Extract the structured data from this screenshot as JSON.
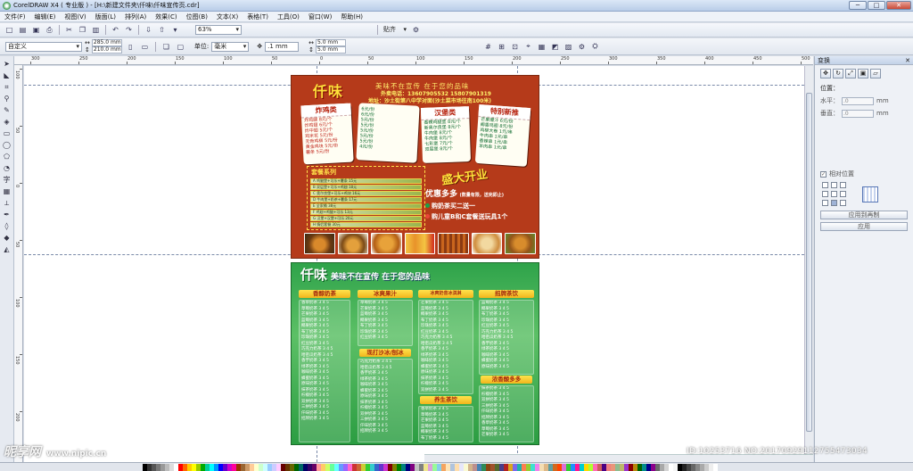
{
  "window": {
    "title": "CorelDRAW X4 ( 专业版 ) - [H:\\新建文件夹\\仟味\\仟味宣传页.cdr]",
    "minimize_label": "─",
    "maximize_label": "□",
    "close_label": "✕"
  },
  "menu": [
    "文件(F)",
    "编辑(E)",
    "视图(V)",
    "版面(L)",
    "排列(A)",
    "效果(C)",
    "位图(B)",
    "文本(X)",
    "表格(T)",
    "工具(O)",
    "窗口(W)",
    "帮助(H)"
  ],
  "toolbar": {
    "zoom": "63%",
    "snap_label": "贴齐"
  },
  "propbar": {
    "paper": "自定义",
    "width": "285.0 mm",
    "height": "210.0 mm",
    "units_label": "单位:",
    "units": "毫米",
    "nudge": ".1 mm",
    "dup_x": "5.0 mm",
    "dup_y": "5.0 mm"
  },
  "ruler": {
    "top_ticks": [
      "300",
      "250",
      "200",
      "150",
      "100",
      "50",
      "0",
      "50",
      "100",
      "150",
      "200",
      "250",
      "300",
      "350",
      "400",
      "450",
      "500"
    ],
    "left_ticks": [
      "100",
      "50",
      "0",
      "50",
      "100",
      "150",
      "200"
    ]
  },
  "flyer_top": {
    "brand": "仟味",
    "slogan": "美味不在宣传    在于您的品味",
    "phone": "外卖电话：13607905532  15807901319",
    "address": "地址：沙土街第八中学对面(沙土菜市场往南100米)",
    "fried_title": "炸鸡类",
    "fried_items": [
      "炸鸡腿   8元/个",
      "炸鸡翅   6元/个",
      "炸中翅   5元/个",
      "鸡米花   5元/份",
      "无骨鸡柳  5元/份",
      "黄金鸡块  5元/份",
      "薯条     5元/份"
    ],
    "mid_items": [
      "6元/份",
      "6元/份",
      "5元/份",
      "5元/份",
      "5元/份",
      "5元/份",
      "5元/份",
      "4元/份"
    ],
    "burger_title": "汉堡类",
    "burger_items": [
      "香辣鸡腿堡  8元/个",
      "新奥尔良堡  8元/个",
      "牛肉堡    8元/个",
      "牛肉堡    8元/个",
      "七彩堡    7元/个",
      "双层堡    8元/个"
    ],
    "special_title": "特别新推",
    "special_items": [
      "芒果爆汁   6元/份",
      "椰香鸡翅   8元/份",
      "鸡柳大卷   1元/串",
      "牛肉串    1元/串",
      "香辣串    1元/串",
      "羊肉串    1元/串"
    ],
    "combo_title": "套餐系列",
    "combos": [
      "A 鸡腿堡+可乐+薯条   15元",
      "B 双层堡+可乐+鸡翅   18元",
      "C 奥尔良堡+可乐+鸡块  16元",
      "D 牛肉堡+奶茶+薯条   17元",
      "E 全家桶      38元",
      "F 鸡翅+鸡腿+可乐    13元",
      "G 汉堡+汉堡+可乐    20元",
      "H 情侣套餐      30元"
    ],
    "grand_opening": "盛大开业",
    "promo_title": "优惠多多",
    "promo_note": "(数量有限，送完即止)",
    "promo_items": [
      "购奶茶买二送一",
      "购儿童B和C套餐送玩具1个"
    ]
  },
  "flyer_bottom": {
    "brand": "仟味",
    "slogan": "美味不在宣传     在于您的品味",
    "headers": [
      "香醇奶茶",
      "冰爽果汁",
      "冰爽奶昔冰淇淋",
      "招牌茶饮",
      "现打沙冰/刨冰",
      "养生茶饮",
      "浓香酸多多"
    ],
    "rows": [
      "香草奶茶  3 4 5",
      "草莓奶茶  3 4 5",
      "芒果奶茶  3 4 5",
      "蓝莓奶茶  3 4 5",
      "椰果奶茶  3 4 5",
      "布丁奶茶  3 4 5",
      "珍珠奶茶  3 4 5",
      "红豆奶茶  3 4 5",
      "巧克力奶茶 3 4 5",
      "哈密瓜奶茶 3 4 5",
      "香芋奶茶  3 4 5",
      "绿茶奶茶  3 4 5",
      "咖啡奶茶  3 4 5",
      "蜂蜜奶茶  3 4 5",
      "原味奶茶  3 4 5",
      "抹茶奶茶  3 4 5",
      "柠檬奶茶  3 4 5",
      "双拼奶茶  3 4 5",
      "三拼奶茶  3 4 5",
      "仟味奶茶  3 4 5",
      "招牌奶茶  3 4 5"
    ]
  },
  "docker": {
    "title": "变换",
    "position_label": "位置：",
    "h_label": "水平：",
    "v_label": "垂直：",
    "h_value": ".0",
    "v_value": ".0",
    "unit": "mm",
    "relative_label": "相对位置",
    "apply_dup_label": "应用到再制",
    "apply_label": "应用"
  },
  "watermark": {
    "left_logo": "昵享网",
    "left_url": "www.nipic.cn",
    "right_id": "ID:10253716 NO:20170929112755473034"
  }
}
